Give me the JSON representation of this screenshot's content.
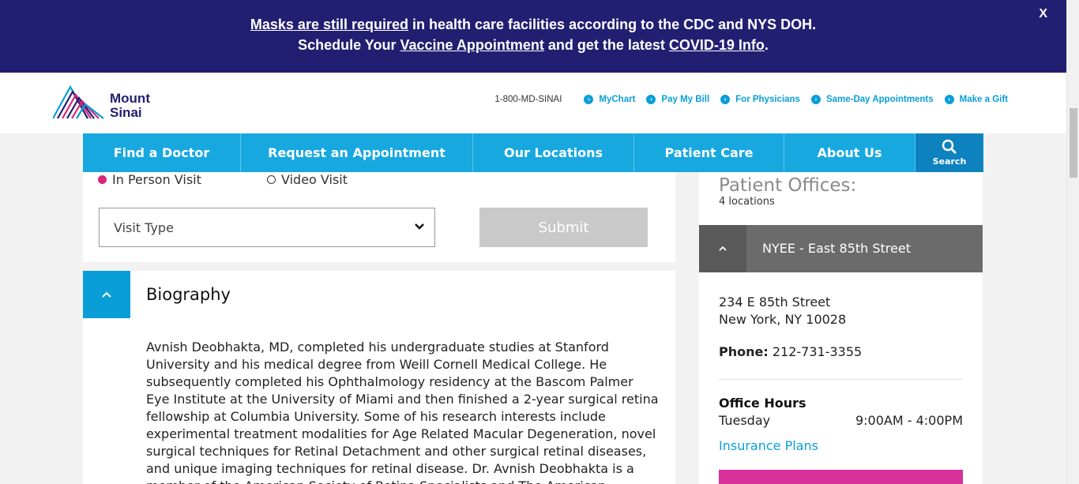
{
  "banner": {
    "line1_link": "Masks are still required",
    "line1_rest": " in health care facilities according to the CDC and NYS DOH.",
    "line2_start": "Schedule Your ",
    "line2_link1": "Vaccine Appointment",
    "line2_mid": " and get the latest ",
    "line2_link2": "COVID-19 Info",
    "line2_end": ".",
    "close": "X"
  },
  "header": {
    "logo_line1": "Mount",
    "logo_line2": "Sinai",
    "phone": "1-800-MD-SINAI",
    "links": [
      "MyChart",
      "Pay My Bill",
      "For Physicians",
      "Same-Day Appointments",
      "Make a Gift"
    ]
  },
  "nav": {
    "items": [
      "Find a Doctor",
      "Request an Appointment",
      "Our Locations",
      "Patient Care",
      "About Us"
    ],
    "search_label": "Search"
  },
  "appointment": {
    "in_person": "In Person Visit",
    "video": "Video Visit",
    "visit_type": "Visit Type",
    "submit": "Submit"
  },
  "biography": {
    "title": "Biography",
    "text": "Avnish Deobhakta, MD, completed his undergraduate studies at Stanford University and his medical degree from Weill Cornell Medical College. He subsequently completed his Ophthalmology residency at the Bascom Palmer Eye Institute at the University of Miami and then finished a 2-year surgical retina fellowship at Columbia University. Some of his research interests include experimental treatment modalities for Age Related Macular Degeneration, novel surgical techniques for Retinal Detachment and other surgical retinal diseases, and unique imaging techniques for retinal disease. Dr. Avnish Deobhakta is a member of the American Society of Retina Specialists and The American"
  },
  "offices": {
    "heading": "Patient Offices:",
    "count": "4 locations",
    "location_name": "NYEE - East 85th Street",
    "address1": "234 E 85th Street",
    "address2": "New York, NY 10028",
    "phone_label": "Phone:",
    "phone": "212-731-3355",
    "hours_title": "Office Hours",
    "hours_day": "Tuesday",
    "hours_time": "9:00AM - 4:00PM",
    "insurance": "Insurance Plans"
  },
  "colors": {
    "banner": "#221f72",
    "nav": "#18a8e0",
    "accent": "#0a9ed8",
    "pink": "#d7309a"
  }
}
